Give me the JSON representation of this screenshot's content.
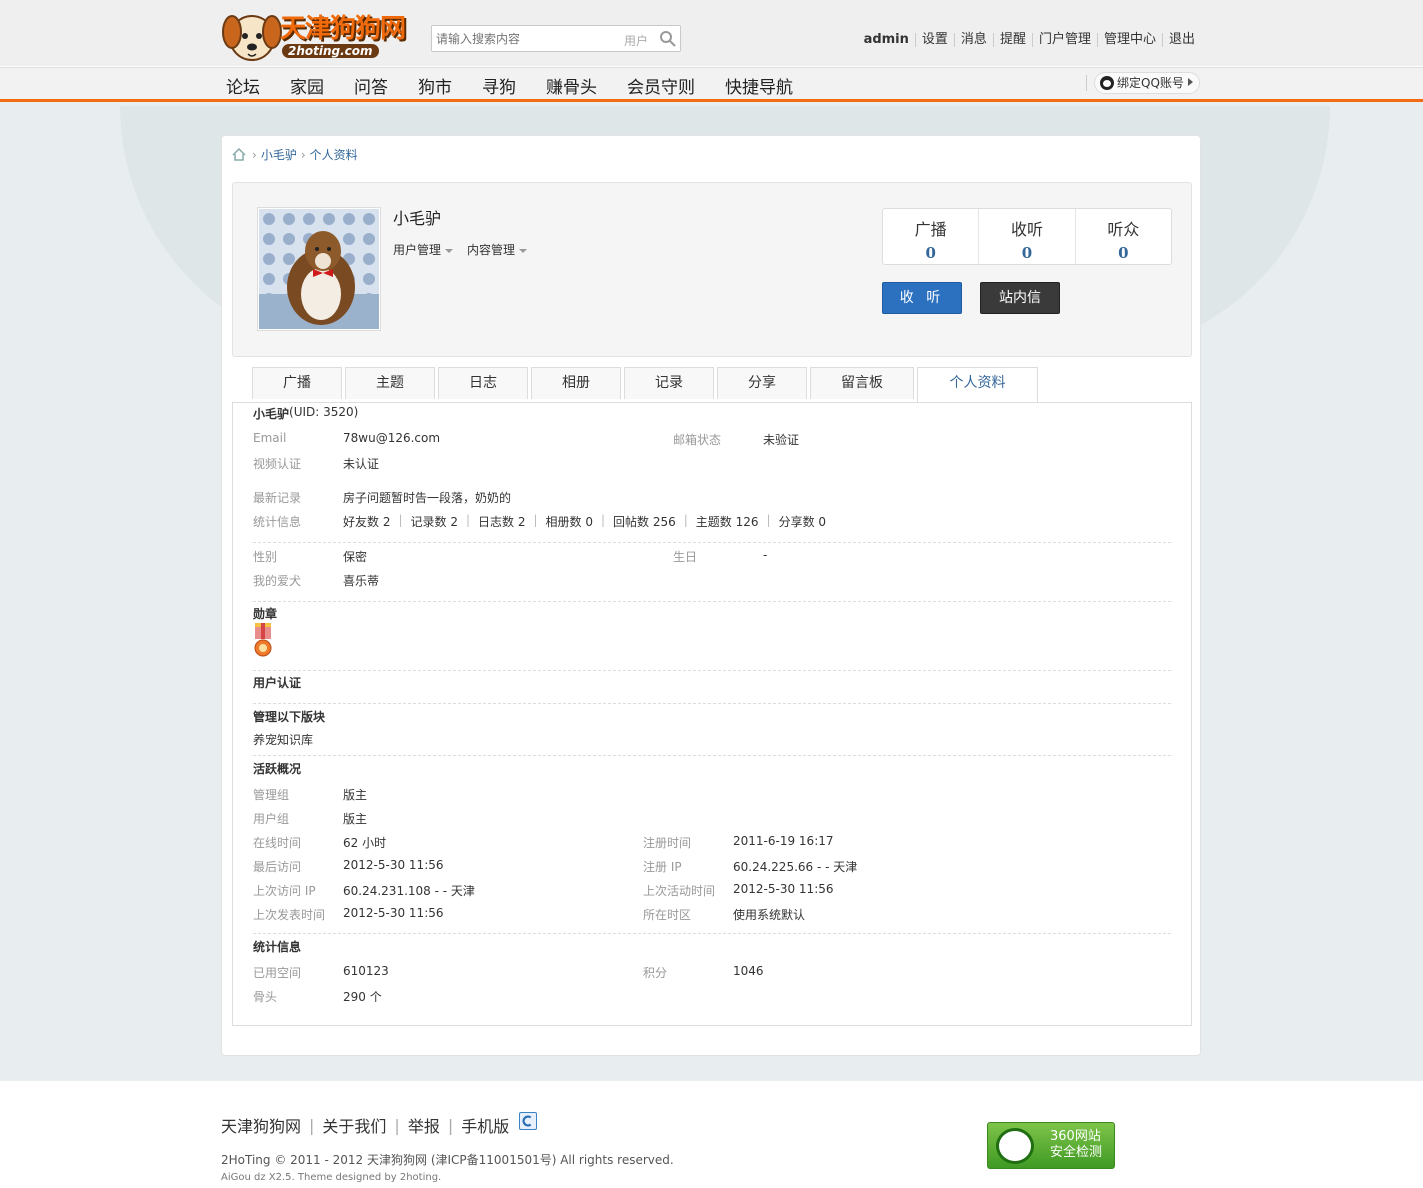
{
  "header": {
    "logo_text": "天津狗狗网",
    "logo_sub": "2hoting.com",
    "search_placeholder": "请输入搜索内容",
    "search_scope": "用户",
    "user_links": [
      "admin",
      "设置",
      "消息",
      "提醒",
      "门户管理",
      "管理中心",
      "退出"
    ]
  },
  "nav": {
    "items": [
      "论坛",
      "家园",
      "问答",
      "狗市",
      "寻狗",
      "赚骨头",
      "会员守则",
      "快捷导航"
    ],
    "qq_bind": "绑定QQ账号"
  },
  "breadcrumb": [
    "小毛驴",
    "个人资料"
  ],
  "profile": {
    "name": "小毛驴",
    "menus": [
      "用户管理",
      "内容管理"
    ],
    "stats": [
      {
        "label": "广播",
        "value": "0"
      },
      {
        "label": "收听",
        "value": "0"
      },
      {
        "label": "听众",
        "value": "0"
      }
    ],
    "follow_label": "收 听",
    "pm_label": "站内信"
  },
  "tabs": [
    "广播",
    "主题",
    "日志",
    "相册",
    "记录",
    "分享",
    "留言板",
    "个人资料"
  ],
  "info": {
    "uid_name": "小毛驴",
    "uid_text": "(UID: 3520)",
    "email_label": "Email",
    "email": "78wu@126.com",
    "email_status_label": "邮箱状态",
    "email_status": "未验证",
    "video_label": "视频认证",
    "video": "未认证",
    "latest_label": "最新记录",
    "latest": "房子问题暂时告一段落，奶奶的",
    "stats_label": "统计信息",
    "stats_items": [
      "好友数 2",
      "记录数 2",
      "日志数 2",
      "相册数 0",
      "回帖数 256",
      "主题数 126",
      "分享数 0"
    ],
    "gender_label": "性别",
    "gender": "保密",
    "birthday_label": "生日",
    "birthday": "-",
    "dog_label": "我的爱犬",
    "dog": "喜乐蒂",
    "medal_title": "勋章",
    "auth_title": "用户认证",
    "manage_title": "管理以下版块",
    "manage_board": "养宠知识库",
    "activity_title": "活跃概况",
    "admin_group_label": "管理组",
    "admin_group": "版主",
    "user_group_label": "用户组",
    "user_group": "版主",
    "online_label": "在线时间",
    "online": "62 小时",
    "reg_time_label": "注册时间",
    "reg_time": "2011-6-19 16:17",
    "last_visit_label": "最后访问",
    "last_visit": "2012-5-30 11:56",
    "reg_ip_label": "注册 IP",
    "reg_ip": "60.24.225.66 - - 天津",
    "last_ip_label": "上次访问 IP",
    "last_ip": "60.24.231.108 - - 天津",
    "last_active_label": "上次活动时间",
    "last_active": "2012-5-30 11:56",
    "last_post_label": "上次发表时间",
    "last_post": "2012-5-30 11:56",
    "timezone_label": "所在时区",
    "timezone": "使用系统默认",
    "stat_title": "统计信息",
    "space_label": "已用空间",
    "space": "610123",
    "points_label": "积分",
    "points": "1046",
    "bones_label": "骨头",
    "bones": "290 个"
  },
  "footer": {
    "links": [
      "天津狗狗网",
      "关于我们",
      "举报",
      "手机版"
    ],
    "copyright": "2HoTing © 2011 - 2012 天津狗狗网 (津ICP备11001501号) All rights reserved.",
    "powered": "AiGou dz X2.5. Theme designed by 2hoting.",
    "badge_line1": "360网站",
    "badge_line2": "安全检测"
  },
  "colors": {
    "accent": "#f26b13",
    "link": "#336699",
    "follow_btn": "#2b71c0",
    "pm_btn": "#3a3a3a"
  }
}
